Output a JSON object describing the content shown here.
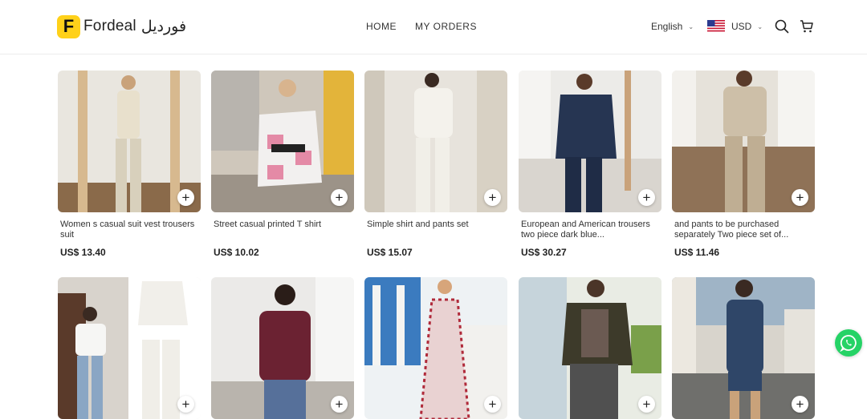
{
  "brand": {
    "logo_letter": "F",
    "name": "Fordeal",
    "name_arabic": "فورديل",
    "accent": "#FFD11A"
  },
  "nav": {
    "items": [
      "HOME",
      "MY ORDERS"
    ]
  },
  "header": {
    "language": "English",
    "currency": "USD"
  },
  "icons": {
    "search": "search-icon",
    "cart": "cart-icon",
    "flag": "us-flag-icon",
    "whatsapp": "whatsapp-icon",
    "add": "plus-icon"
  },
  "products": [
    {
      "name": "Women s casual suit vest trousers suit",
      "price": "US$ 13.40"
    },
    {
      "name": "Street casual printed T shirt",
      "price": "US$ 10.02"
    },
    {
      "name": "Simple shirt and pants set",
      "price": "US$ 15.07"
    },
    {
      "name": "European and American trousers two piece dark blue...",
      "price": "US$ 30.27"
    },
    {
      "name": "and pants to be purchased separately Two piece set of...",
      "price": "US$ 11.46"
    },
    {
      "name": "",
      "price": ""
    },
    {
      "name": "",
      "price": ""
    },
    {
      "name": "",
      "price": ""
    },
    {
      "name": "",
      "price": ""
    },
    {
      "name": "",
      "price": ""
    }
  ],
  "colors": {
    "whatsapp": "#25D366",
    "text": "#222222",
    "divider": "#ececec"
  }
}
